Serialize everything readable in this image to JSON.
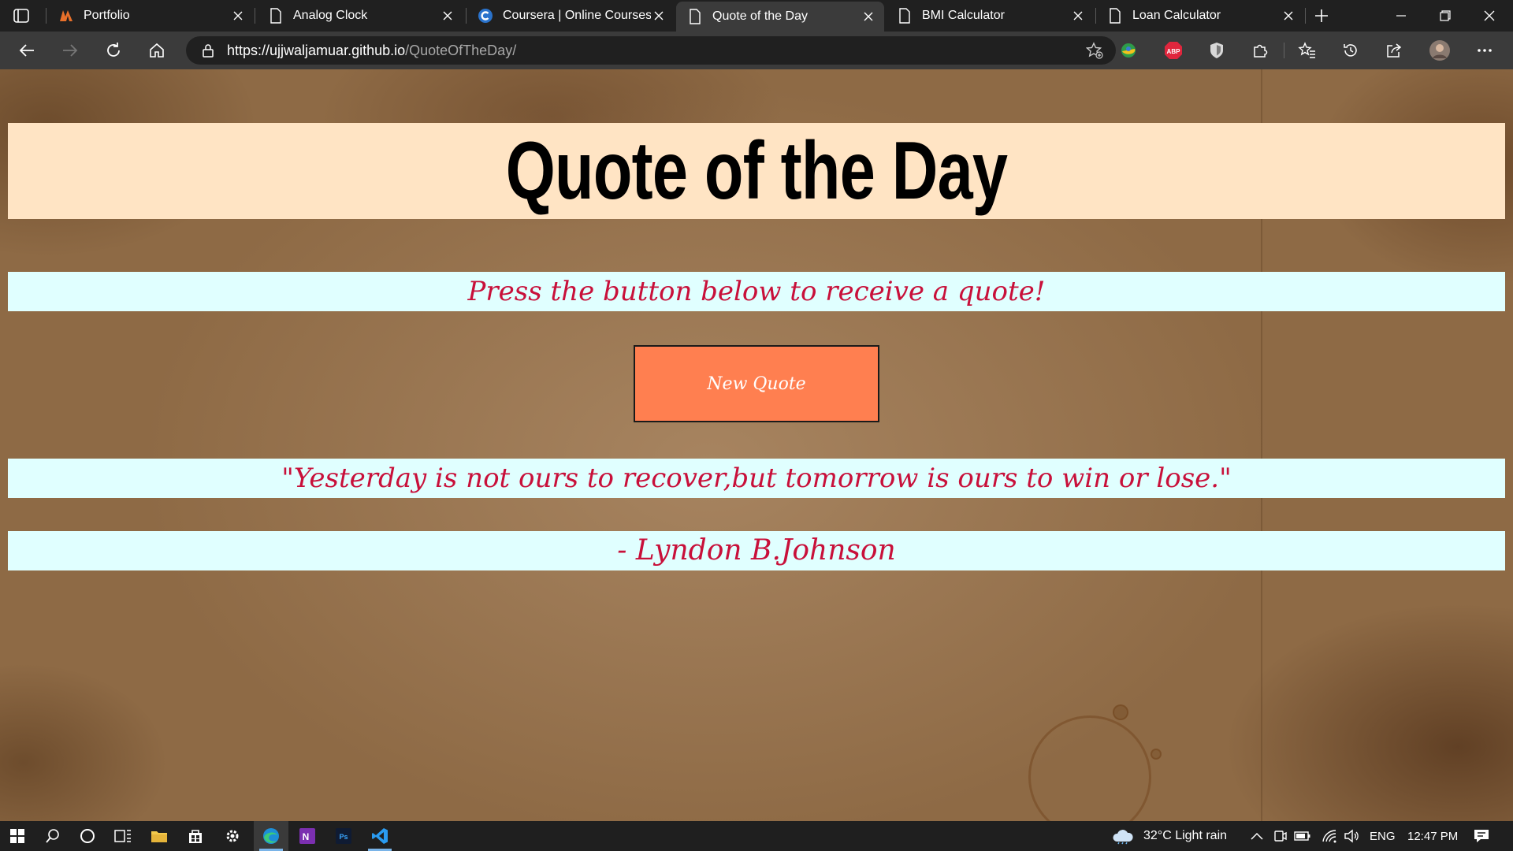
{
  "browser": {
    "tabs": [
      {
        "title": "Portfolio",
        "icon": "portfolio-logo-icon",
        "active": false
      },
      {
        "title": "Analog Clock",
        "icon": "page-icon",
        "active": false
      },
      {
        "title": "Coursera | Online Courses & Credentials From Top Educators",
        "icon": "coursera-logo-icon",
        "active": false
      },
      {
        "title": "Quote of the Day",
        "icon": "page-icon",
        "active": true
      },
      {
        "title": "BMI Calculator",
        "icon": "page-icon",
        "active": false
      },
      {
        "title": "Loan Calculator",
        "icon": "page-icon",
        "active": false
      }
    ],
    "address": {
      "url_host": "https://ujjwaljamuar.github.io",
      "url_path": "/QuoteOfTheDay/"
    }
  },
  "page": {
    "title": "Quote of the Day",
    "prompt": "Press the button below to receive a quote!",
    "button_label": "New Quote",
    "quote": "\"Yesterday is not ours to recover,but tomorrow is ours to win or lose.\"",
    "author": "- Lyndon B.Johnson",
    "colors": {
      "title_bg": "#ffe4c4",
      "band_bg": "#e0ffff",
      "text_accent": "#c8103a",
      "button_bg": "#ff7f50"
    }
  },
  "taskbar": {
    "weather": "32°C  Light rain",
    "language": "ENG",
    "time": "12:47 PM"
  }
}
